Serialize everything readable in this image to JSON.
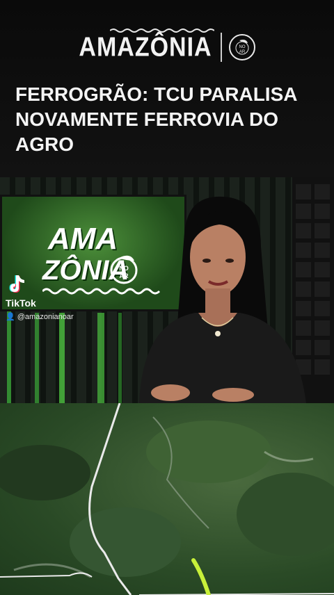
{
  "brand": {
    "logo_text": "AMAZÔNIA",
    "seal_text_top": "NO",
    "seal_text_bottom": "AR"
  },
  "headline": "FERROGRÃO: TCU PARALISA NOVAMENTE FERROVIA DO AGRO",
  "tv_screen": {
    "line1": "AMA",
    "line2": "ZÔNIA",
    "seal_top": "NO",
    "seal_bottom": "AR"
  },
  "tiktok": {
    "app_name": "TikTok",
    "username": "@amazonianoar"
  },
  "colors": {
    "background": "#0b0b0b",
    "headline": "#f4f4f4",
    "route_highlight": "#c8f03a"
  },
  "icons": [
    "tiktok-logo-icon",
    "user-icon",
    "leaf-icon"
  ]
}
